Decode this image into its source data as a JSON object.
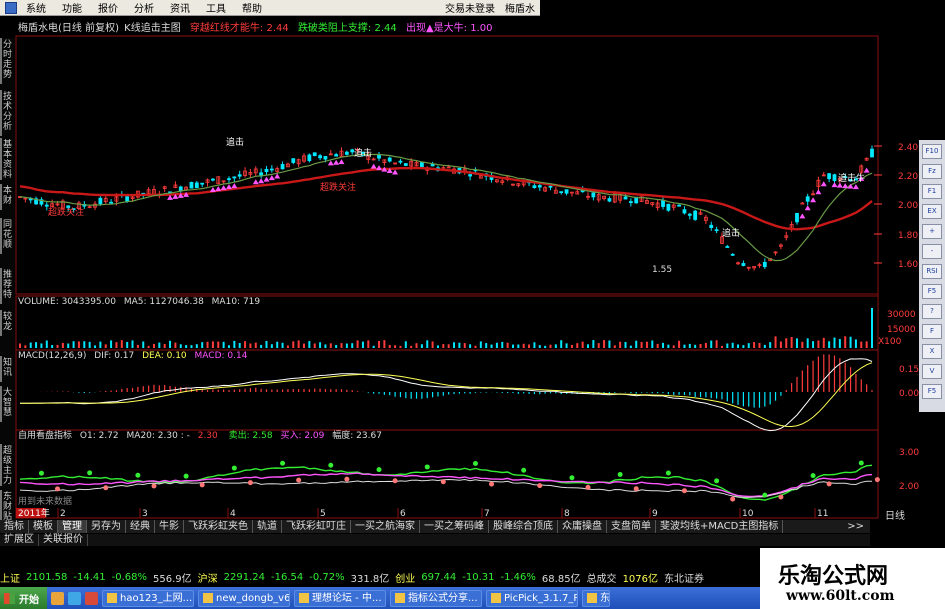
{
  "menu": {
    "items": [
      "系统",
      "功能",
      "报价",
      "分析",
      "资讯",
      "工具",
      "帮助"
    ],
    "status": "交易未登录",
    "app": "梅盾水"
  },
  "title": {
    "name": "梅盾水电(日线 前复权)",
    "indicator": "K线追击主图",
    "sig1": "穿越红线才能牛: 2.44",
    "sig2": "跌破类阻上支撑: 2.44",
    "sig3": "出现▲是大牛: 1.00"
  },
  "left_sidebar": [
    "分时走势",
    "技术分析",
    "基本资料",
    "本财",
    "同花顺",
    "推荐特",
    "较龙",
    "知讯",
    "大智慧",
    "超级主力",
    "东财贴吧"
  ],
  "right_toolbar": [
    "F10",
    "Fz",
    "F1",
    "EX",
    "+",
    "-",
    "RSI",
    "F5",
    "?",
    "F",
    "X",
    "V",
    "F5"
  ],
  "price_axis": {
    "ticks": [
      "2.40",
      "2.20",
      "2.00",
      "1.80",
      "1.60"
    ]
  },
  "annotations": {
    "low": "1.55",
    "hit1": "追击",
    "hit2": "追击",
    "hit3": "追击",
    "hit4": "追击牛",
    "focus1": "超跌关注",
    "focus2": "超跌关注"
  },
  "volume": {
    "title": "VOLUME: 3043395.00",
    "ma5": "MA5: 1127046.38",
    "ma10": "MA10: 719",
    "ticks": [
      "30000",
      "15000"
    ],
    "unit": "X100"
  },
  "macd": {
    "title": "MACD(12,26,9)",
    "dif": "DIF: 0.17",
    "dea": "DEA: 0.10",
    "macd": "MACD: 0.14",
    "ticks": [
      "0.15",
      "0.00"
    ]
  },
  "custom": {
    "title": "自用看盘指标",
    "o1": "O1: 2.72",
    "ma20": "MA20: 2.30",
    "sep": ": -",
    "val": "2.30",
    "sell": "卖出: 2.58",
    "buy": "买入: 2.09",
    "amp": "幅度: 23.67",
    "ticks": [
      "3.00",
      "2.00"
    ],
    "note": "用到未来数据"
  },
  "time_axis": {
    "year": "2011年",
    "months": [
      "2",
      "3",
      "4",
      "5",
      "6",
      "7",
      "8",
      "9",
      "10",
      "11"
    ],
    "period": "日线"
  },
  "func_tabs": [
    "指标",
    "模板",
    "管理",
    "另存为",
    "经典",
    "牛影",
    "飞跃彩虹夹色",
    "轨道",
    "飞跃彩虹叮庄",
    "一买之航海家",
    "一买之筹码峰",
    "股峰综合顶底",
    "众庸操盘",
    "支盘简单",
    "斐波均线+MACD主图指标"
  ],
  "func_more": ">>",
  "func_tabs2": [
    "扩展区",
    "关联报价"
  ],
  "ticker": [
    {
      "name": "上证",
      "price": "2101.58",
      "chg": "-14.41",
      "pct": "-0.68%",
      "amt": "556.9亿"
    },
    {
      "name": "沪深",
      "price": "2291.24",
      "chg": "-16.54",
      "pct": "-0.72%",
      "amt": "331.8亿"
    },
    {
      "name": "创业",
      "price": "697.44",
      "chg": "-10.31",
      "pct": "-1.46%",
      "amt": "68.85亿"
    }
  ],
  "ticker_extra": [
    "总成交",
    "1076亿",
    "东北证券"
  ],
  "taskbar": {
    "start": "开始",
    "items": [
      "hao123_上网...",
      "new_dongb_v6.1",
      "理想论坛 - 中...",
      "指标公式分享...",
      "PicPick_3.1.7_P...",
      "东"
    ]
  },
  "watermark": {
    "line1": "乐淘公式网",
    "line2": "www.60lt.com"
  },
  "colors": {
    "up": "#ff3c3c",
    "down": "#00ffff",
    "ma_red": "#c81818",
    "ma_green": "#5a8a3c",
    "magenta": "#ff55ff",
    "yellow": "#ffff55",
    "green": "#33ee33"
  }
}
